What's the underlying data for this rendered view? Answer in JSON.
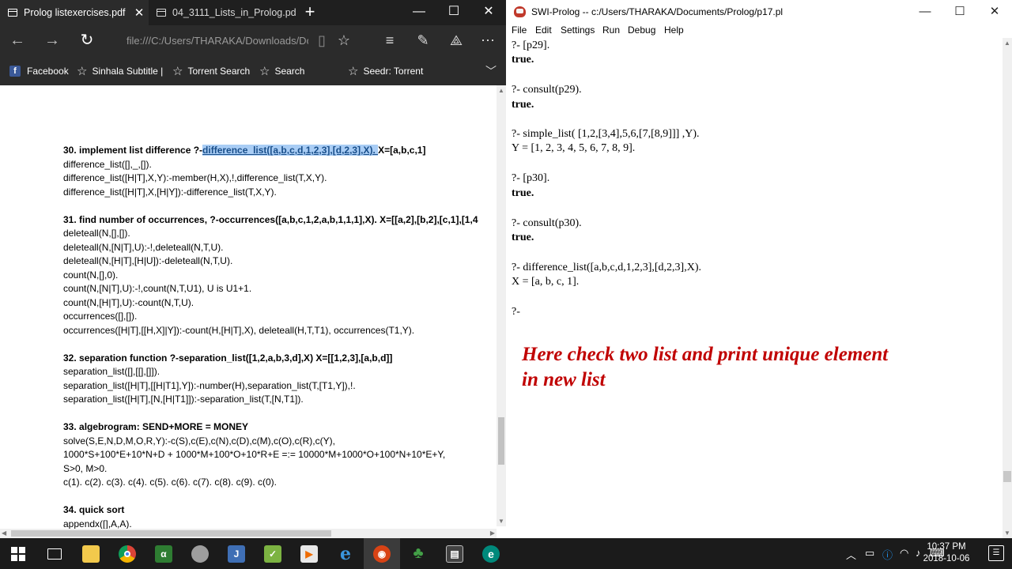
{
  "edge": {
    "tabs": [
      {
        "title": "Prolog listexercises.pdf",
        "active": true
      },
      {
        "title": "04_3111_Lists_in_Prolog.pdf",
        "active": false
      }
    ],
    "address": "file:///C:/Users/THARAKA/Downloads/Dc",
    "favorites": [
      "Facebook",
      "Sinhala Subtitle |",
      "Torrent Search",
      "Search",
      "Seedr: Torrent"
    ],
    "pdf_lines": [
      {
        "text": "30. implement list difference ?-",
        "bold": true,
        "highlight": "difference_list([a,b,c,d,1,2,3],[d,2,3],X). ",
        "after": "X=[a,b,c,1]"
      },
      {
        "text": "difference_list([],_,[])."
      },
      {
        "text": "difference_list([H|T],X,Y):-member(H,X),!,difference_list(T,X,Y)."
      },
      {
        "text": "difference_list([H|T],X,[H|Y]):-difference_list(T,X,Y)."
      },
      {
        "gap": true
      },
      {
        "text": "31. find number of occurrences, ?-occurrences([a,b,c,1,2,a,b,1,1,1],X). X=[[a,2],[b,2],[c,1],[1,4",
        "bold": true
      },
      {
        "text": "deleteall(N,[],[])."
      },
      {
        "text": "deleteall(N,[N|T],U):-!,deleteall(N,T,U)."
      },
      {
        "text": "deleteall(N,[H|T],[H|U]):-deleteall(N,T,U)."
      },
      {
        "text": "count(N,[],0)."
      },
      {
        "text": "count(N,[N|T],U):-!,count(N,T,U1), U is U1+1."
      },
      {
        "text": "count(N,[H|T],U):-count(N,T,U)."
      },
      {
        "text": "occurrences([],[])."
      },
      {
        "text": "occurrences([H|T],[[H,X]|Y]):-count(H,[H|T],X), deleteall(H,T,T1), occurrences(T1,Y)."
      },
      {
        "gap": true
      },
      {
        "text": "32. separation function ?-separation_list([1,2,a,b,3,d],X) X=[[1,2,3],[a,b,d]]",
        "bold": true
      },
      {
        "text": "separation_list([],[[],[]])."
      },
      {
        "text": "separation_list([H|T],[[H|T1],Y]):-number(H),separation_list(T,[T1,Y]),!."
      },
      {
        "text": "separation_list([H|T],[N,[H|T1]]):-separation_list(T,[N,T1])."
      },
      {
        "gap": true
      },
      {
        "text": "33. algebrogram: SEND+MORE = MONEY",
        "bold": true
      },
      {
        "text": "solve(S,E,N,D,M,O,R,Y):-c(S),c(E),c(N),c(D),c(M),c(O),c(R),c(Y),"
      },
      {
        "text": "1000*S+100*E+10*N+D + 1000*M+100*O+10*R+E =:= 10000*M+1000*O+100*N+10*E+Y,"
      },
      {
        "text": "S>0, M>0."
      },
      {
        "text": "c(1). c(2). c(3). c(4). c(5). c(6). c(7). c(8). c(9). c(0)."
      },
      {
        "gap": true
      },
      {
        "text": "34. quick sort",
        "bold": true
      },
      {
        "text": "appendx([],A,A)."
      }
    ]
  },
  "prolog": {
    "title": "SWI-Prolog -- c:/Users/THARAKA/Documents/Prolog/p17.pl",
    "menu": [
      "File",
      "Edit",
      "Settings",
      "Run",
      "Debug",
      "Help"
    ],
    "console": [
      {
        "text": "?- [p29].",
        "bold": false
      },
      {
        "text": "true.",
        "bold": true
      },
      {
        "text": "?- consult(p29).",
        "bold": false
      },
      {
        "text": "true.",
        "bold": true
      },
      {
        "text": "?- simple_list( [1,2,[3,4],5,6,[7,[8,9]]] ,Y).",
        "bold": false
      },
      {
        "text": "Y = [1, 2, 3, 4, 5, 6, 7, 8, 9].",
        "bold": false
      },
      {
        "text": "?- [p30].",
        "bold": false
      },
      {
        "text": "true.",
        "bold": true
      },
      {
        "text": "?- consult(p30).",
        "bold": false
      },
      {
        "text": "true.",
        "bold": true
      },
      {
        "text": "?- difference_list([a,b,c,d,1,2,3],[d,2,3],X).",
        "bold": false
      },
      {
        "text": "X = [a, b, c, 1].",
        "bold": false
      },
      {
        "text": "?-",
        "bold": false
      }
    ],
    "annotation_line1": "Here check two list and print unique element",
    "annotation_line2": "in new list",
    "annotation_color": "#c00000"
  },
  "taskbar": {
    "apps": [
      "start",
      "task-view",
      "file-explorer",
      "chrome",
      "app",
      "app",
      "app",
      "app",
      "media-player",
      "edge",
      "swi-prolog",
      "app",
      "app",
      "app"
    ],
    "time": "10:37 PM",
    "date": "2018-10-06"
  }
}
